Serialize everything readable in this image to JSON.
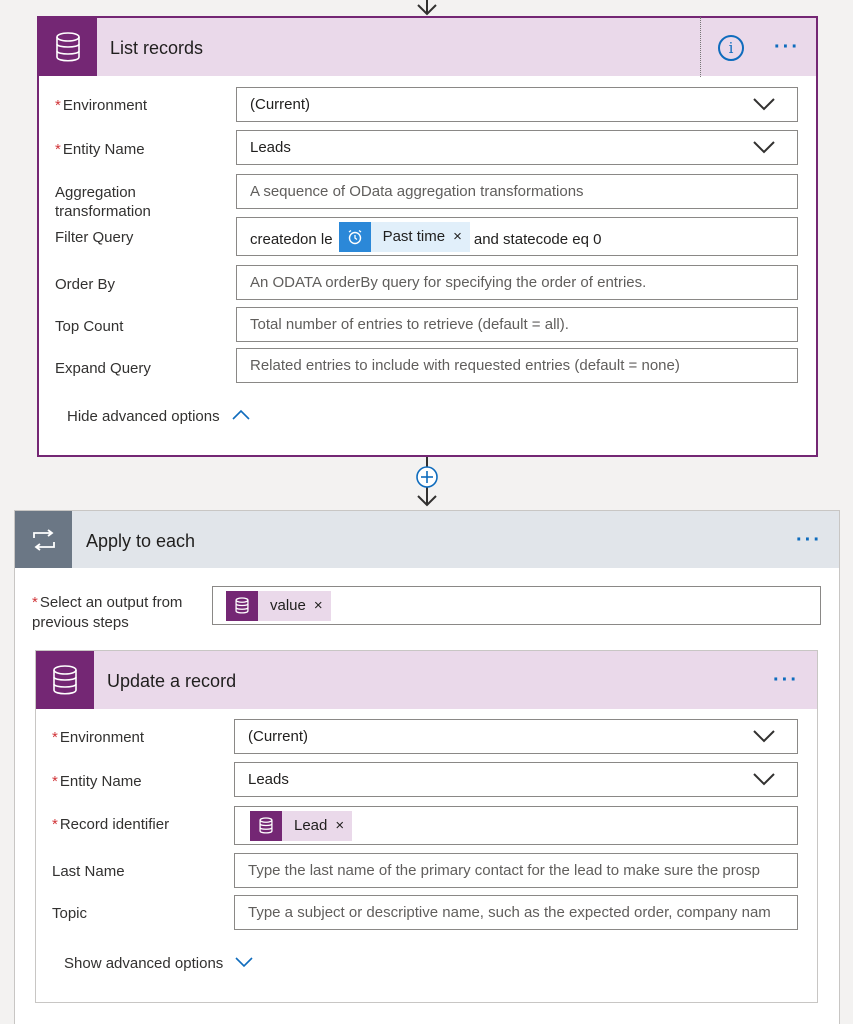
{
  "list_records": {
    "title": "List records",
    "info_icon": "i",
    "more": "···",
    "fields": {
      "environment": {
        "label": "Environment",
        "value": "(Current)"
      },
      "entity": {
        "label": "Entity Name",
        "value": "Leads"
      },
      "aggregation": {
        "label": "Aggregation transformation",
        "placeholder": "A sequence of OData aggregation transformations"
      },
      "filter": {
        "label": "Filter Query",
        "prefix": "createdon le",
        "token": "Past time",
        "suffix": "and statecode eq 0"
      },
      "orderby": {
        "label": "Order By",
        "placeholder": "An ODATA orderBy query for specifying the order of entries."
      },
      "top": {
        "label": "Top Count",
        "placeholder": "Total number of entries to retrieve (default = all)."
      },
      "expand": {
        "label": "Expand Query",
        "placeholder": "Related entries to include with requested entries (default = none)"
      }
    },
    "advanced": "Hide advanced options"
  },
  "apply_each": {
    "title": "Apply to each",
    "more": "···",
    "select_label": "Select an output from previous steps",
    "select_token": "value"
  },
  "update_record": {
    "title": "Update a record",
    "more": "···",
    "fields": {
      "environment": {
        "label": "Environment",
        "value": "(Current)"
      },
      "entity": {
        "label": "Entity Name",
        "value": "Leads"
      },
      "record_id": {
        "label": "Record identifier",
        "token": "Lead"
      },
      "lastname": {
        "label": "Last Name",
        "placeholder": "Type the last name of the primary contact for the lead to make sure the prosp"
      },
      "topic": {
        "label": "Topic",
        "placeholder": "Type a subject or descriptive name, such as the expected order, company nam"
      }
    },
    "advanced": "Show advanced options"
  },
  "token_remove": "×",
  "required_marker": "*"
}
